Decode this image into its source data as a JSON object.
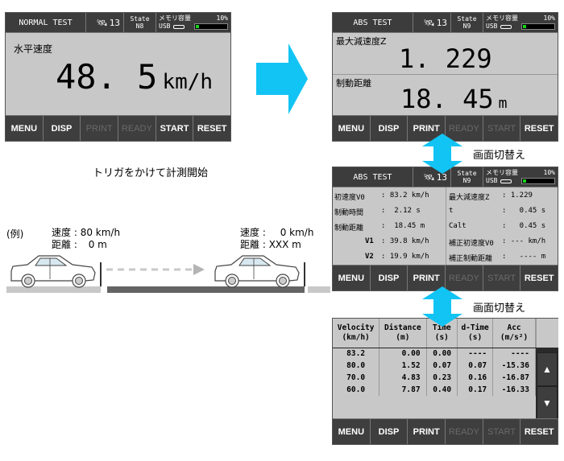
{
  "colors": {
    "accent_arrow": "#12c4f4",
    "panel_bg": "#c8c8c8",
    "header_bg": "#3c3c3c",
    "memory_fill": "#19d119"
  },
  "panels": {
    "normal": {
      "header": {
        "title": "NORMAL TEST",
        "sat_count": "13",
        "state_label": "State",
        "state_value": "N8",
        "memory_label": "メモリ容量",
        "memory_pct_text": "10%",
        "memory_fraction": 0.1,
        "usb_label": "USB"
      },
      "label": "水平速度",
      "value": "48. 5",
      "unit": "km/h",
      "buttons": [
        {
          "label": "MENU",
          "enabled": true
        },
        {
          "label": "DISP",
          "enabled": true
        },
        {
          "label": "PRINT",
          "enabled": false
        },
        {
          "label": "READY",
          "enabled": false
        },
        {
          "label": "START",
          "enabled": true
        },
        {
          "label": "RESET",
          "enabled": true
        }
      ]
    },
    "abs_big": {
      "header": {
        "title": "ABS TEST",
        "sat_count": "13",
        "state_label": "State",
        "state_value": "N9",
        "memory_label": "メモリ容量",
        "memory_pct_text": "10%",
        "memory_fraction": 0.1,
        "usb_label": "USB"
      },
      "label1": "最大減速度Z",
      "value1": "1. 229",
      "label2": "制動距離",
      "value2": "18. 45",
      "unit2": "m",
      "buttons": [
        {
          "label": "MENU",
          "enabled": true
        },
        {
          "label": "DISP",
          "enabled": true
        },
        {
          "label": "PRINT",
          "enabled": true
        },
        {
          "label": "READY",
          "enabled": false
        },
        {
          "label": "START",
          "enabled": false
        },
        {
          "label": "RESET",
          "enabled": true
        }
      ]
    },
    "abs_detail": {
      "header": {
        "title": "ABS TEST",
        "sat_count": "13",
        "state_label": "State",
        "state_value": "N9",
        "memory_label": "メモリ容量",
        "memory_pct_text": "10%",
        "memory_fraction": 0.1,
        "usb_label": "USB"
      },
      "left": [
        {
          "label": "初速度V0",
          "value": ": 83.2 km/h"
        },
        {
          "label": "制動時間",
          "value": ":  2.12 s"
        },
        {
          "label": "制動距離",
          "value": ":  18.45 m"
        },
        {
          "label": "V1",
          "value": ": 39.8 km/h"
        },
        {
          "label": "V2",
          "value": ": 19.9 km/h"
        }
      ],
      "right": [
        {
          "label": "最大減速度Z",
          "value": ": 1.229"
        },
        {
          "label": "t",
          "value": ":   0.45 s"
        },
        {
          "label": "Calt",
          "value": ":   0.45 s"
        },
        {
          "label": "補正初速度V0",
          "value": ": --- km/h"
        },
        {
          "label": "補正制動距離",
          "value": ":   ---- m"
        }
      ],
      "buttons": [
        {
          "label": "MENU",
          "enabled": true
        },
        {
          "label": "DISP",
          "enabled": true
        },
        {
          "label": "PRINT",
          "enabled": true
        },
        {
          "label": "READY",
          "enabled": false
        },
        {
          "label": "START",
          "enabled": false
        },
        {
          "label": "RESET",
          "enabled": true
        }
      ]
    },
    "table": {
      "columns": [
        {
          "name": "Velocity",
          "unit": "(km/h)"
        },
        {
          "name": "Distance",
          "unit": "(m)"
        },
        {
          "name": "Time",
          "unit": "(s)"
        },
        {
          "name": "d-Time",
          "unit": "(s)"
        },
        {
          "name": "Acc",
          "unit": "(m/s²)"
        }
      ],
      "rows": [
        [
          "83.2",
          "0.00",
          "0.00",
          "----",
          "----"
        ],
        [
          "80.0",
          "1.52",
          "0.07",
          "0.07",
          "-15.36"
        ],
        [
          "70.0",
          "4.83",
          "0.23",
          "0.16",
          "-16.87"
        ],
        [
          "60.0",
          "7.87",
          "0.40",
          "0.17",
          "-16.33"
        ]
      ],
      "scroll_up": "▲",
      "scroll_down": "▼",
      "buttons": [
        {
          "label": "MENU",
          "enabled": true
        },
        {
          "label": "DISP",
          "enabled": true
        },
        {
          "label": "PRINT",
          "enabled": true
        },
        {
          "label": "READY",
          "enabled": false
        },
        {
          "label": "START",
          "enabled": false
        },
        {
          "label": "RESET",
          "enabled": true
        }
      ]
    }
  },
  "annotations": {
    "switch_screen_1": "画面切替え",
    "switch_screen_2": "画面切替え",
    "trigger_caption": "トリガをかけて計測開始",
    "example_label": "(例)",
    "start": {
      "speed_label": "速度 :",
      "speed_value": "80 km/h",
      "distance_label": "距離 :",
      "distance_value": "0 m"
    },
    "end": {
      "speed_label": "速度 :",
      "speed_value": "0  km/h",
      "distance_label": "距離 :",
      "distance_value": "XXX m"
    }
  }
}
